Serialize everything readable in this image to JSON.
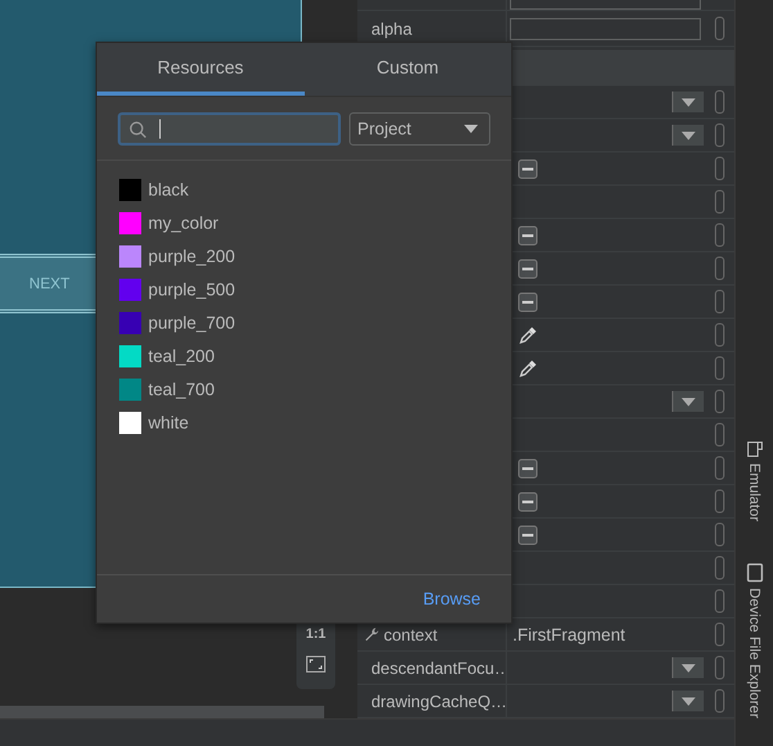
{
  "canvas": {
    "button_label": "NEXT"
  },
  "zoom_controls": {
    "actual_size": "1:1"
  },
  "attributes": {
    "rows": [
      {
        "kind": "field"
      },
      {
        "kind": "field",
        "label": "alpha"
      },
      {
        "kind": "header"
      },
      {
        "kind": "dropdown"
      },
      {
        "kind": "dropdown"
      },
      {
        "kind": "flag"
      },
      {
        "kind": "empty"
      },
      {
        "kind": "flag"
      },
      {
        "kind": "flag"
      },
      {
        "kind": "flag"
      },
      {
        "kind": "color"
      },
      {
        "kind": "color"
      },
      {
        "kind": "dropdown"
      },
      {
        "kind": "empty"
      },
      {
        "kind": "flag"
      },
      {
        "kind": "flag"
      },
      {
        "kind": "flag"
      },
      {
        "kind": "empty"
      },
      {
        "kind": "empty"
      },
      {
        "kind": "linked",
        "label": "context",
        "value": ".FirstFragment"
      },
      {
        "kind": "dropdown",
        "label": "descendantFocu…"
      },
      {
        "kind": "dropdown",
        "label": "drawingCacheQ…"
      }
    ]
  },
  "side_tools": [
    {
      "label": "Emulator",
      "kind": "device"
    },
    {
      "label": "Device File Explorer",
      "kind": "phone"
    }
  ],
  "popup": {
    "tabs": [
      {
        "label": "Resources",
        "selected": true
      },
      {
        "label": "Custom",
        "selected": false
      }
    ],
    "scope": "Project",
    "colors": [
      {
        "name": "black",
        "color": "#000000"
      },
      {
        "name": "my_color",
        "color": "#ff00ff"
      },
      {
        "name": "purple_200",
        "color": "#bb86fc"
      },
      {
        "name": "purple_500",
        "color": "#6200ee"
      },
      {
        "name": "purple_700",
        "color": "#3700b3"
      },
      {
        "name": "teal_200",
        "color": "#03dac5"
      },
      {
        "name": "teal_700",
        "color": "#018786"
      },
      {
        "name": "white",
        "color": "#ffffff"
      }
    ],
    "browse": "Browse"
  }
}
